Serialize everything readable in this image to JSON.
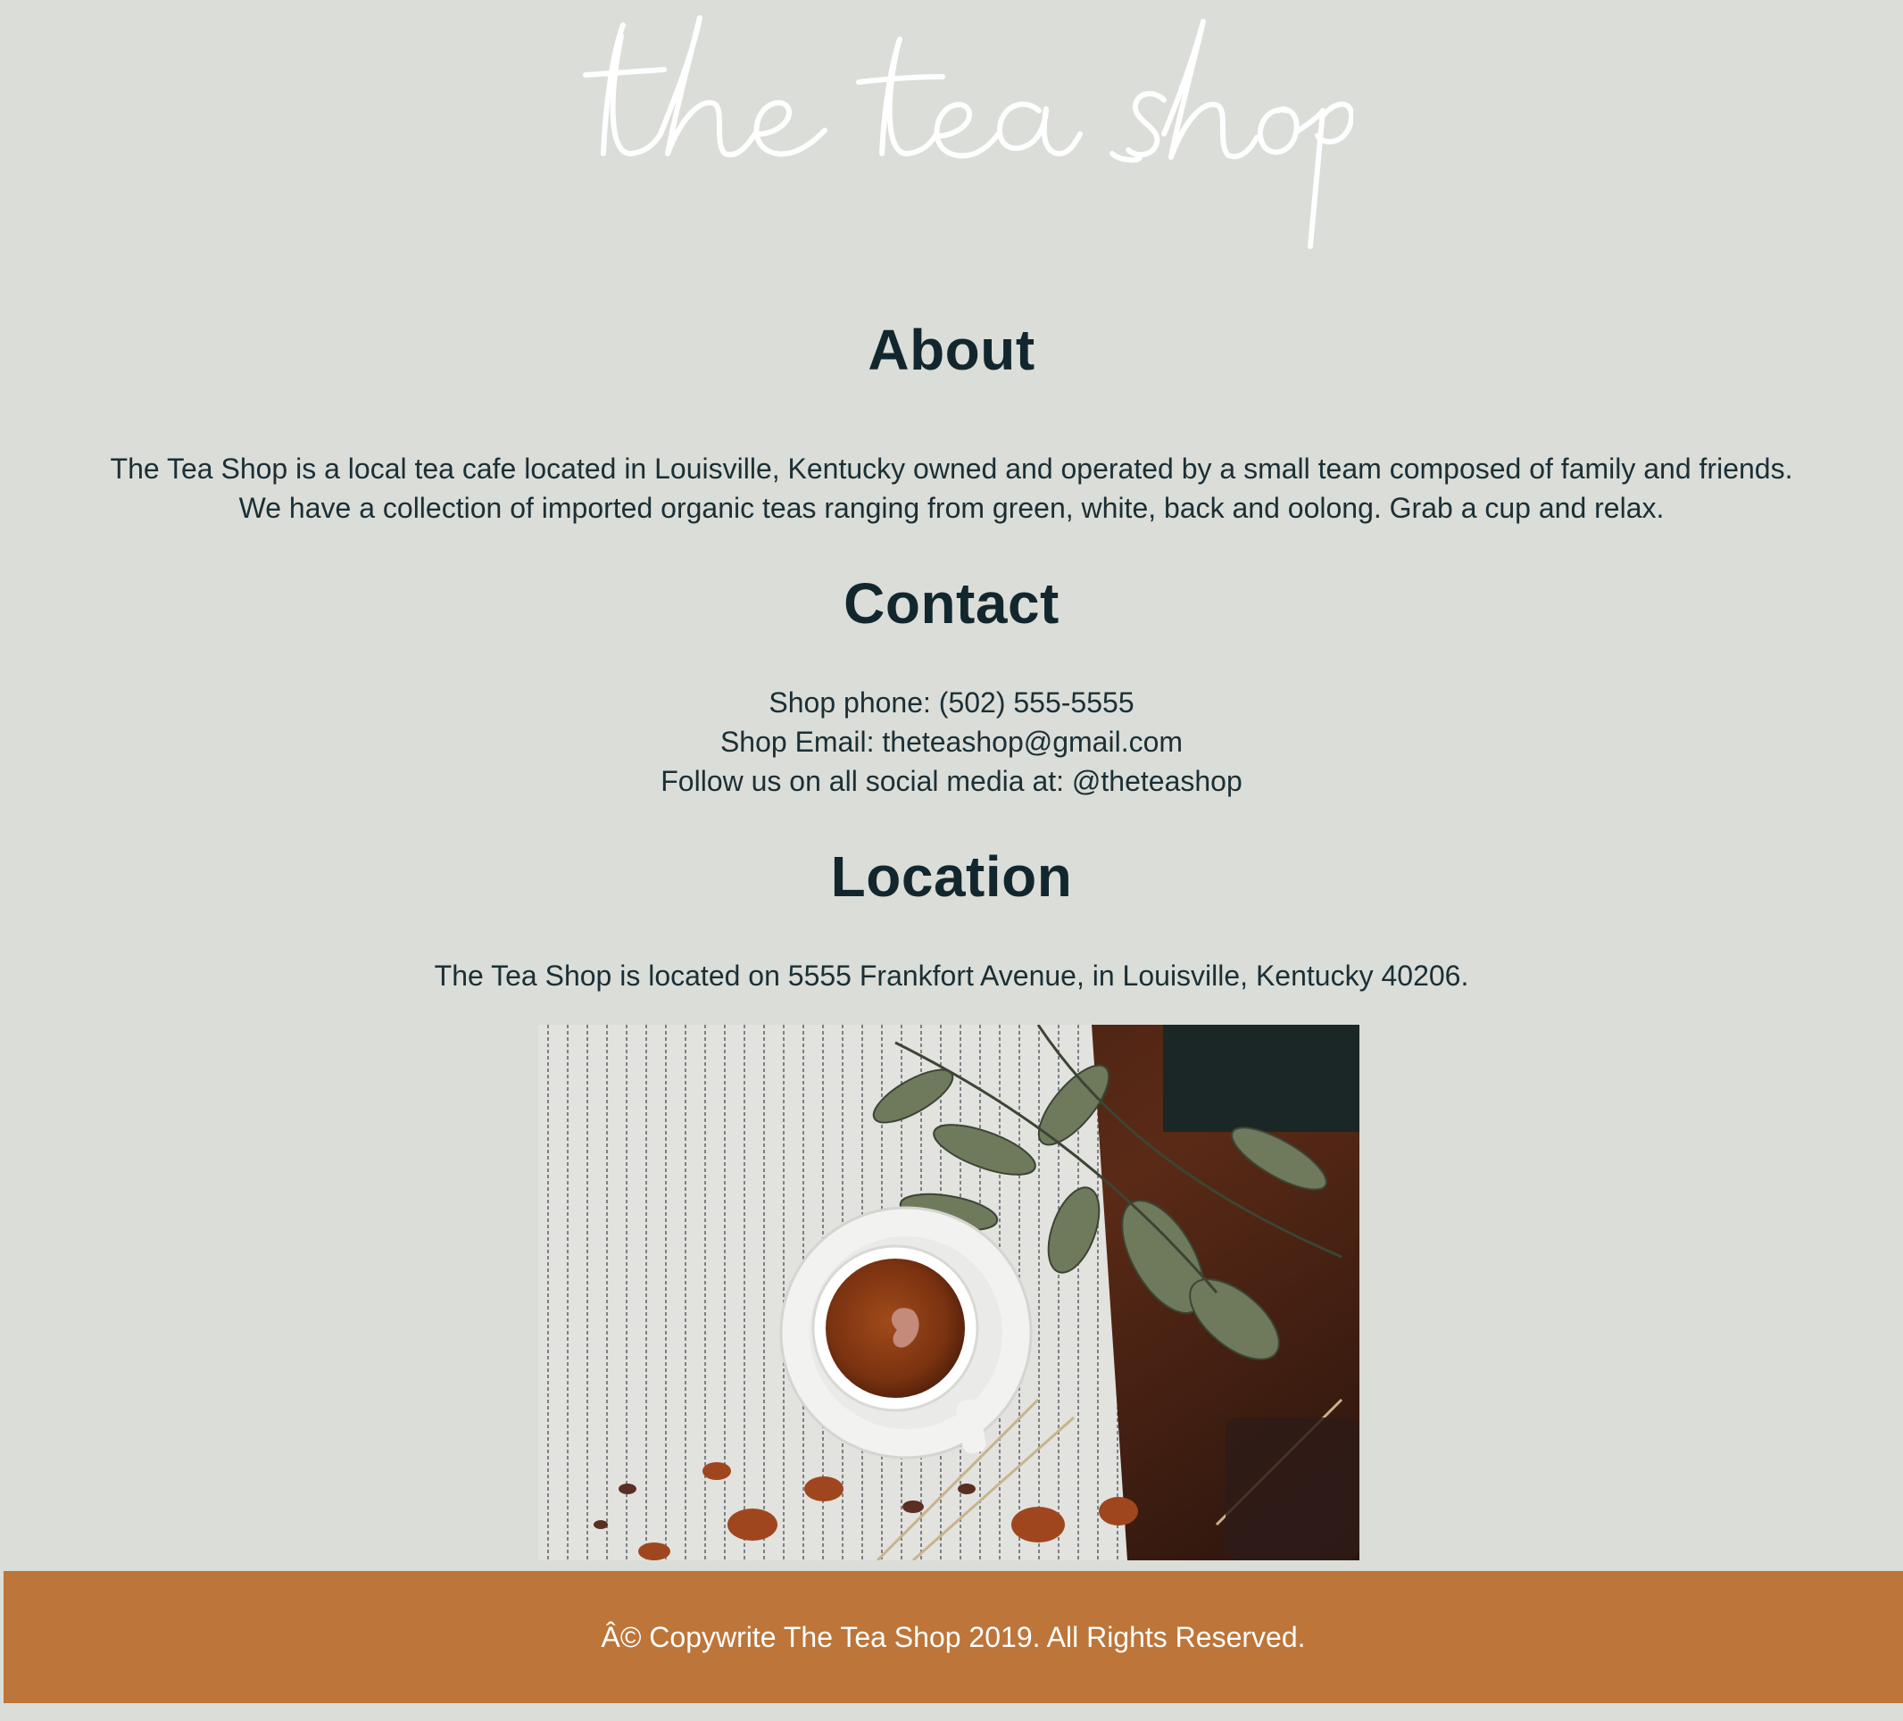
{
  "header": {
    "logo_text": "the tea shop"
  },
  "about": {
    "heading": "About",
    "lines": [
      "The Tea Shop is a local tea cafe located in Louisville, Kentucky owned and operated by a small team composed of family and friends.",
      "We have a collection of imported organic teas ranging from green, white, back and oolong. Grab a cup and relax."
    ]
  },
  "contact": {
    "heading": "Contact",
    "phone": "Shop phone: (502) 555-5555",
    "email": "Shop Email: theteashop@gmail.com",
    "social": "Follow us on all social media at: @theteashop"
  },
  "location": {
    "heading": "Location",
    "address": "The Tea Shop is located on 5555 Frankfort Avenue, in Louisville, Kentucky 40206."
  },
  "footer": {
    "text": "Â© Copywrite The Tea Shop 2019. All Rights Reserved."
  },
  "colors": {
    "background": "#dbddd8",
    "heading": "#12272d",
    "footer": "#bd7539",
    "footer_text": "#ffffff"
  }
}
